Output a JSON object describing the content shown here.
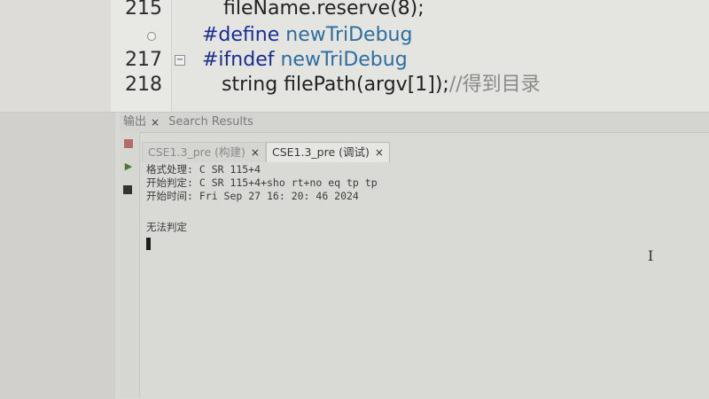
{
  "editor": {
    "lines": [
      {
        "number": "215",
        "segments": [
          {
            "text": "fileName.reserve(8);",
            "cls": "plain"
          }
        ]
      },
      {
        "number": "",
        "segments": [
          {
            "text": "#define ",
            "cls": "kw"
          },
          {
            "text": "newTriDebug",
            "cls": "ident"
          }
        ]
      },
      {
        "number": "217",
        "segments": [
          {
            "text": "#ifndef ",
            "cls": "kw"
          },
          {
            "text": "newTriDebug",
            "cls": "ident"
          }
        ]
      },
      {
        "number": "218",
        "segments": [
          {
            "text": "string filePath(argv[1]);",
            "cls": "plain"
          },
          {
            "text": "//得到目录",
            "cls": "comment"
          }
        ]
      }
    ]
  },
  "panel": {
    "tabs": [
      {
        "label": "输出",
        "close": "×"
      },
      {
        "label": "Search Results",
        "close": ""
      }
    ],
    "subtabs": [
      {
        "label": "CSE1.3_pre (构建)",
        "close": "×",
        "active": false
      },
      {
        "label": "CSE1.3_pre (调试)",
        "close": "×",
        "active": true
      }
    ],
    "console": {
      "lines": [
        "格式处理: C SR 115+4",
        "开始判定: C SR 115+4+sho rt+no eq  tp tp",
        "开始时间: Fri  Sep  27 16: 20: 46  2024",
        "",
        "无法判定"
      ]
    }
  },
  "icons": {
    "fold": "minus-box-icon",
    "bookmark": "bookmark-dot-icon",
    "stop": "stop-icon",
    "run": "run-icon",
    "clear": "clear-icon"
  },
  "colors": {
    "keyword": "#1a2d95",
    "identifier": "#2d6d9f",
    "comment": "#8a8a8a"
  }
}
